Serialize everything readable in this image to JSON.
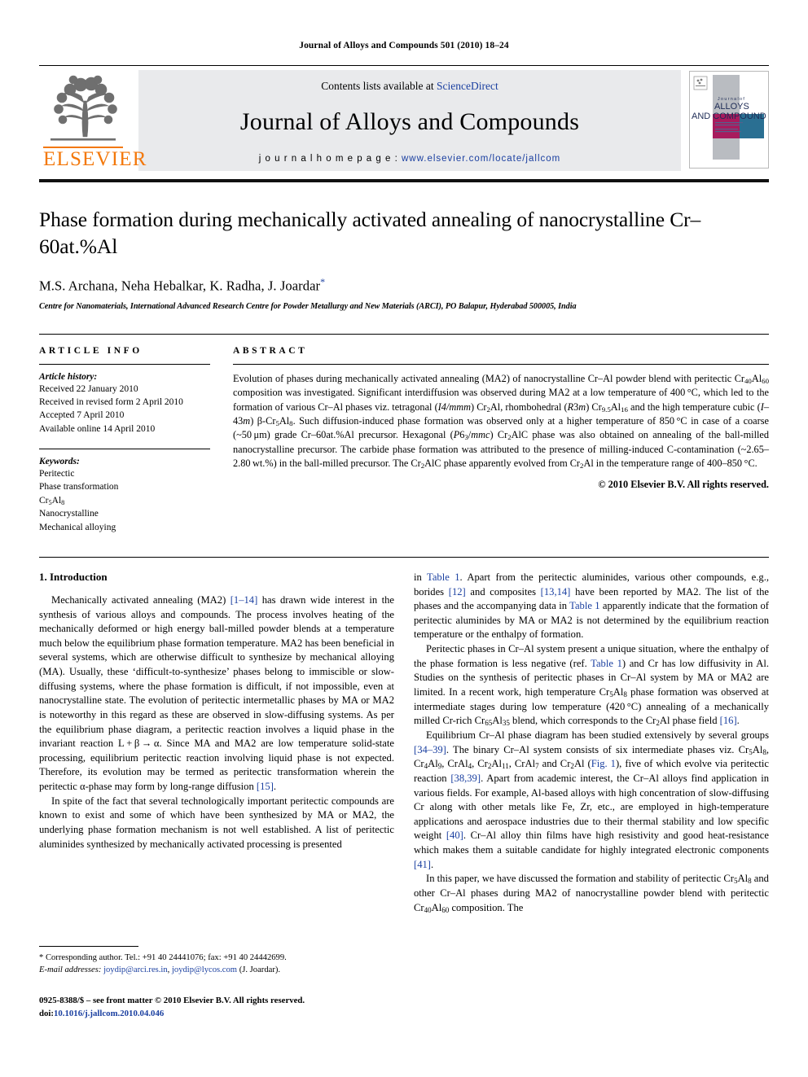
{
  "running_head": "Journal of Alloys and Compounds 501 (2010) 18–24",
  "masthead": {
    "contents_prefix": "Contents lists available at ",
    "sciencedirect": "ScienceDirect",
    "journal_title": "Journal of Alloys and Compounds",
    "homepage_prefix": "j o u r n a l   h o m e p a g e :  ",
    "homepage_url": "www.elsevier.com/locate/jallcom",
    "publisher_wordmark": "ELSEVIER",
    "cover_line1": "Journal of",
    "cover_line2": "ALLOYS",
    "cover_line3": "AND COMPOUNDS"
  },
  "colors": {
    "link": "#1a3fa0",
    "elsevier_orange": "#f3780b",
    "band_gray": "#e9eaec",
    "cover_magenta": "#a81b5d",
    "cover_teal": "#2a6f92",
    "cover_gray": "#b9bcc1"
  },
  "article": {
    "title": "Phase formation during mechanically activated annealing of nanocrystalline Cr–60at.%Al",
    "authors": "M.S. Archana, Neha Hebalkar, K. Radha, J. Joardar",
    "corresponding_marker": "*",
    "affiliation": "Centre for Nanomaterials, International Advanced Research Centre for Powder Metallurgy and New Materials (ARCI), PO Balapur, Hyderabad 500005, India"
  },
  "article_info": {
    "heading": "ARTICLE INFO",
    "history_label": "Article history:",
    "history": [
      "Received 22 January 2010",
      "Received in revised form 2 April 2010",
      "Accepted 7 April 2010",
      "Available online 14 April 2010"
    ],
    "keywords_label": "Keywords:",
    "keywords": [
      "Peritectic",
      "Phase transformation",
      "Cr5Al8",
      "Nanocrystalline",
      "Mechanical alloying"
    ]
  },
  "abstract": {
    "heading": "ABSTRACT",
    "copyright": "© 2010 Elsevier B.V. All rights reserved."
  },
  "body": {
    "section1_title": "1.  Introduction",
    "footnote_corresponding": "* Corresponding author. Tel.: +91 40 24441076; fax: +91 40 24442699.",
    "footnote_email_label": "E-mail addresses:",
    "footnote_email1": "joydip@arci.res.in",
    "footnote_email2": "joydip@lycos.com",
    "footnote_email_suffix": "(J. Joardar).",
    "imprint_line": "0925-8388/$ – see front matter © 2010 Elsevier B.V. All rights reserved.",
    "doi_label": "doi:",
    "doi_value": "10.1016/j.jallcom.2010.04.046"
  }
}
